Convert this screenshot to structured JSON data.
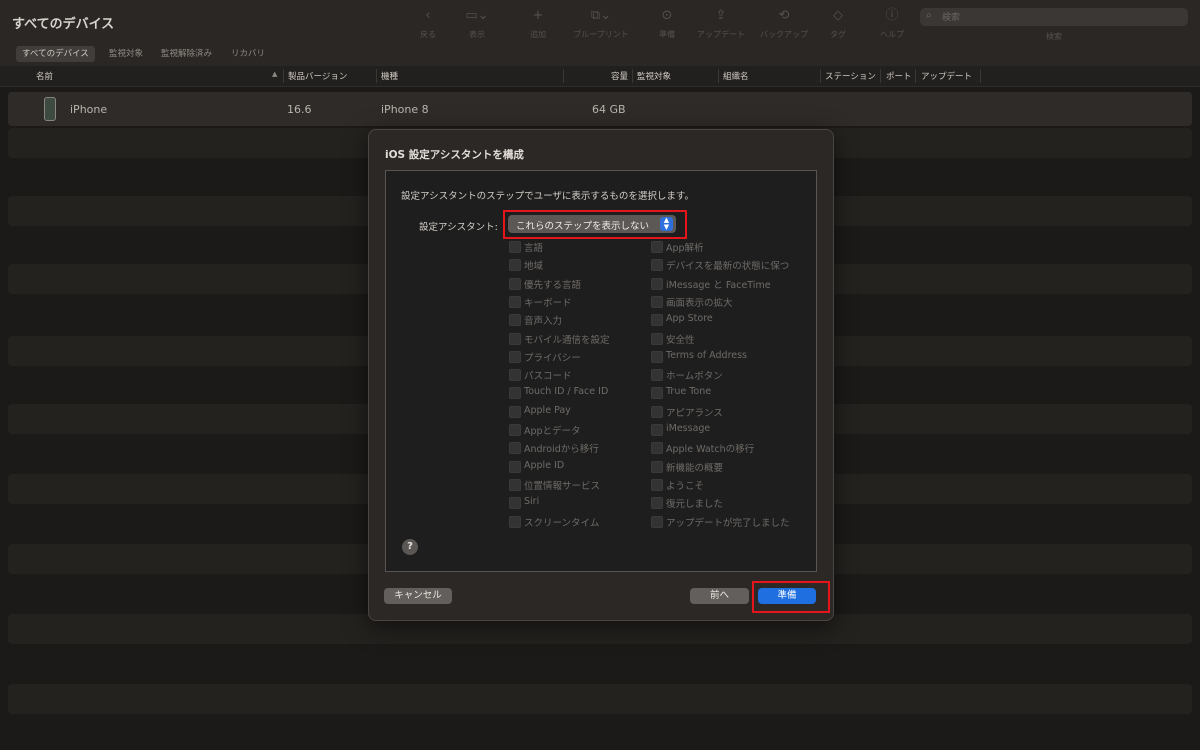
{
  "app": {
    "title": "すべてのデバイス"
  },
  "toolbar": {
    "buttons": [
      {
        "label": "戻る",
        "icon": "chevron-left-icon"
      },
      {
        "label": "表示",
        "icon": "view-icon"
      },
      {
        "label": "追加",
        "icon": "plus-icon"
      },
      {
        "label": "ブループリント",
        "icon": "blueprint-icon"
      },
      {
        "label": "準備",
        "icon": "prepare-icon"
      },
      {
        "label": "アップデート",
        "icon": "update-icon"
      },
      {
        "label": "バックアップ",
        "icon": "backup-icon"
      },
      {
        "label": "タグ",
        "icon": "tag-icon"
      },
      {
        "label": "ヘルプ",
        "icon": "help-icon"
      }
    ],
    "search": {
      "placeholder": "検索",
      "label": "検索"
    }
  },
  "filter_tabs": [
    "すべてのデバイス",
    "監視対象",
    "監視解除済み",
    "リカバリ"
  ],
  "table": {
    "columns": [
      "名前",
      "製品バージョン",
      "機種",
      "容量",
      "監視対象",
      "組織名",
      "ステーション",
      "ポート",
      "アップデート"
    ],
    "rows": [
      {
        "name": "iPhone",
        "version": "16.6",
        "model": "iPhone 8",
        "capacity": "64 GB"
      }
    ]
  },
  "dialog": {
    "title": "iOS 設定アシスタントを構成",
    "instruction": "設定アシスタントのステップでユーザに表示するものを選択します。",
    "select_label": "設定アシスタント:",
    "select_value": "これらのステップを表示しない",
    "left_options": [
      "言語",
      "地域",
      "優先する言語",
      "キーボード",
      "音声入力",
      "モバイル通信を設定",
      "プライバシー",
      "パスコード",
      "Touch ID / Face ID",
      "Apple Pay",
      "Appとデータ",
      "Androidから移行",
      "Apple ID",
      "位置情報サービス",
      "Siri",
      "スクリーンタイム"
    ],
    "right_options": [
      "App解析",
      "デバイスを最新の状態に保つ",
      "iMessage と FaceTime",
      "画面表示の拡大",
      "App Store",
      "安全性",
      "Terms of Address",
      "ホームボタン",
      "True Tone",
      "アピアランス",
      "iMessage",
      "Apple Watchの移行",
      "新機能の概要",
      "ようこそ",
      "復元しました",
      "アップデートが完了しました"
    ],
    "help": "?",
    "cancel": "キャンセル",
    "back": "前へ",
    "prepare": "準備"
  },
  "colors": {
    "accent": "#1f6fe0",
    "highlight": "#e5151b"
  }
}
